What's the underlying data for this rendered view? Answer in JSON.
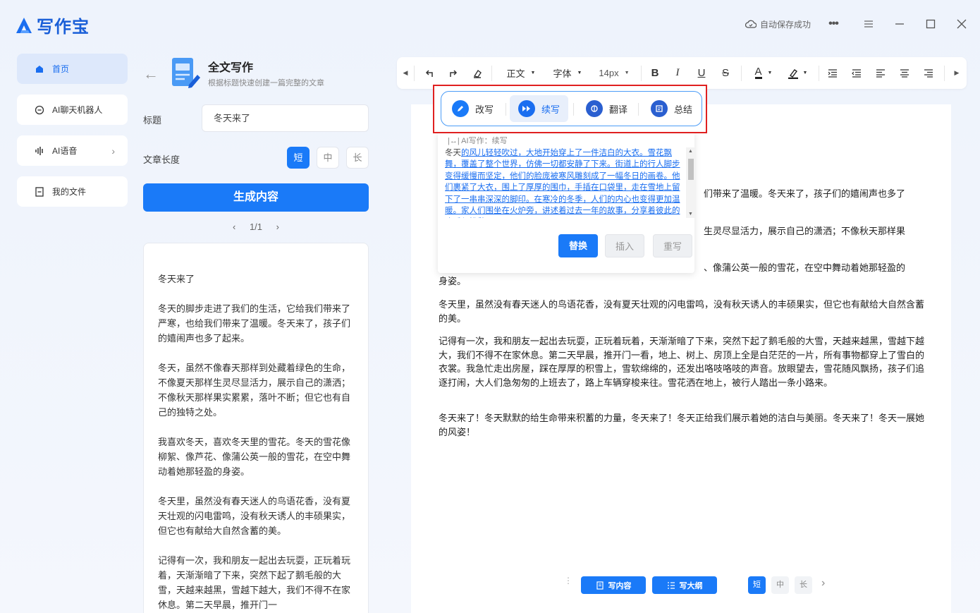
{
  "app": {
    "name": "写作宝",
    "autosave": "自动保存成功"
  },
  "sidebar": {
    "items": [
      {
        "label": "首页"
      },
      {
        "label": "AI聊天机器人"
      },
      {
        "label": "AI语音"
      },
      {
        "label": "我的文件"
      }
    ]
  },
  "panel": {
    "title": "全文写作",
    "subtitle": "根据标题快速创建一篇完整的文章",
    "title_label": "标题",
    "title_value": "冬天来了",
    "length_label": "文章长度",
    "lengths": [
      "短",
      "中",
      "长"
    ],
    "generate": "生成内容",
    "pager": "1/1",
    "result": [
      "冬天来了",
      "冬天的脚步走进了我们的生活，它给我们带来了严寒，也给我们带来了温暖。冬天来了，孩子们的嬉闹声也多了起来。",
      "冬天，虽然不像春天那样到处藏着绿色的生命，不像夏天那样生灵尽显活力，展示自己的潇洒；不像秋天那样果实累累，落叶不断；但它也有自己的独特之处。",
      "我喜欢冬天，喜欢冬天里的雪花。冬天的雪花像柳絮、像芦花、像蒲公英一般的雪花，在空中舞动着她那轻盈的身姿。",
      "冬天里，虽然没有春天迷人的鸟语花香，没有夏天壮观的闪电雷鸣，没有秋天诱人的丰硕果实，但它也有献给大自然含蓄的美。",
      "记得有一次，我和朋友一起出去玩耍，正玩着玩着，天渐渐暗了下来，突然下起了鹅毛般的大雪，天越来越黑，雪越下越大，我们不得不在家休息。第二天早晨，推开门一"
    ]
  },
  "toolbar": {
    "para": "正文",
    "font": "字体",
    "size": "14px",
    "bold": "B",
    "italic": "I",
    "underline": "U",
    "strike": "S",
    "color": "A"
  },
  "ai_menu": {
    "items": [
      "改写",
      "续写",
      "翻译",
      "总结"
    ]
  },
  "ai_popup": {
    "header": "AI写作：续写",
    "text_lead": "冬天",
    "text_u1": "的风儿轻轻吹过，大地开始穿上了一件洁白的大衣。雪花飘舞，覆盖了整个世界，仿佛一切都安静了下来。",
    "text_u2": "街道上的行人脚步变得缓慢而坚定，他们的脸庞被寒风雕刻成了一幅冬日的画卷。他们裹紧了大衣，围上了厚厚的围巾，手插在口袋里，走在雪地上留下了一串串深深的脚印。",
    "text_u3": "在寒冷的冬季，人们的内心也变得更加温暖。家人们围坐在火炉旁，讲述着过去一年的故事，分享着彼此的欢乐与忧愁。",
    "btn_replace": "替换",
    "btn_insert": "插入",
    "btn_rewrite": "重写"
  },
  "editor": {
    "p1_tail": "们带来了温暖。冬天来了，孩子们的嬉闹声也多了",
    "p2_tail": "生灵尽显活力，展示自己的潇洒；不像秋天那样果",
    "p3_tail": "、像蒲公英一般的雪花，在空中舞动着她那轻盈的",
    "p3_line2": "身姿。",
    "p4": "冬天里，虽然没有春天迷人的鸟语花香，没有夏天壮观的闪电雷鸣，没有秋天诱人的丰硕果实，但它也有献给大自然含蓄的美。",
    "p5": "记得有一次，我和朋友一起出去玩耍，正玩着玩着，天渐渐暗了下来，突然下起了鹅毛般的大雪，天越来越黑，雪越下越大，我们不得不在家休息。第二天早晨，推开门一看，地上、树上、房顶上全是白茫茫的一片，所有事物都穿上了雪白的衣裳。我急忙走出房屋，踩在厚厚的积雪上，雪软绵绵的，还发出咯吱咯吱的声音。放眼望去，雪花随风飘扬，孩子们追逐打闹，大人们急匆匆的上班去了，路上车辆穿梭来往。雪花洒在地上，被行人踏出一条小路来。",
    "p6": "冬天来了！冬天默默的给生命带来积蓄的力量，冬天来了！冬天正给我们展示着她的洁白与美丽。冬天来了！冬天一展她的风姿！"
  },
  "bottombar": {
    "write": "写内容",
    "outline": "写大纲",
    "lengths": [
      "短",
      "中",
      "长"
    ]
  }
}
